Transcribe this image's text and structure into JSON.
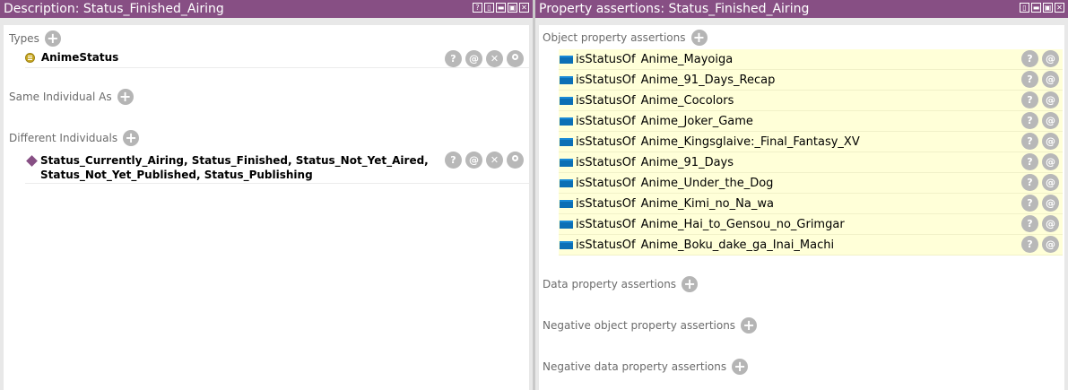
{
  "left": {
    "title": "Description: Status_Finished_Airing",
    "title_buttons": [
      "?",
      "▯",
      "▬",
      "▣",
      "✕"
    ],
    "types_label": "Types",
    "type_value": "AnimeStatus",
    "same_label": "Same Individual As",
    "different_label": "Different Individuals",
    "different_line1": "Status_Currently_Airing, Status_Finished, Status_Not_Yet_Aired,",
    "different_line2": "Status_Not_Yet_Published, Status_Publishing"
  },
  "right": {
    "title": "Property assertions: Status_Finished_Airing",
    "title_buttons": [
      "▯",
      "▬",
      "▣",
      "✕"
    ],
    "object_label": "Object property assertions",
    "assertions": [
      {
        "property": "isStatusOf",
        "value": "Anime_Mayoiga"
      },
      {
        "property": "isStatusOf",
        "value": "Anime_91_Days_Recap"
      },
      {
        "property": "isStatusOf",
        "value": "Anime_Cocolors"
      },
      {
        "property": "isStatusOf",
        "value": "Anime_Joker_Game"
      },
      {
        "property": "isStatusOf",
        "value": "Anime_Kingsglaive:_Final_Fantasy_XV"
      },
      {
        "property": "isStatusOf",
        "value": "Anime_91_Days"
      },
      {
        "property": "isStatusOf",
        "value": "Anime_Under_the_Dog"
      },
      {
        "property": "isStatusOf",
        "value": "Anime_Kimi_no_Na_wa"
      },
      {
        "property": "isStatusOf",
        "value": "Anime_Hai_to_Gensou_no_Grimgar"
      },
      {
        "property": "isStatusOf",
        "value": "Anime_Boku_dake_ga_Inai_Machi"
      }
    ],
    "data_label": "Data property assertions",
    "neg_object_label": "Negative object property assertions",
    "neg_data_label": "Negative data property assertions"
  },
  "action_glyphs": {
    "help": "?",
    "annotate": "@",
    "delete": "✕"
  },
  "colors": {
    "titlebar": "#874f84",
    "assertion_bg": "#ffffd8",
    "property_icon": "#0c6fb5",
    "class_icon": "#c8a721"
  }
}
